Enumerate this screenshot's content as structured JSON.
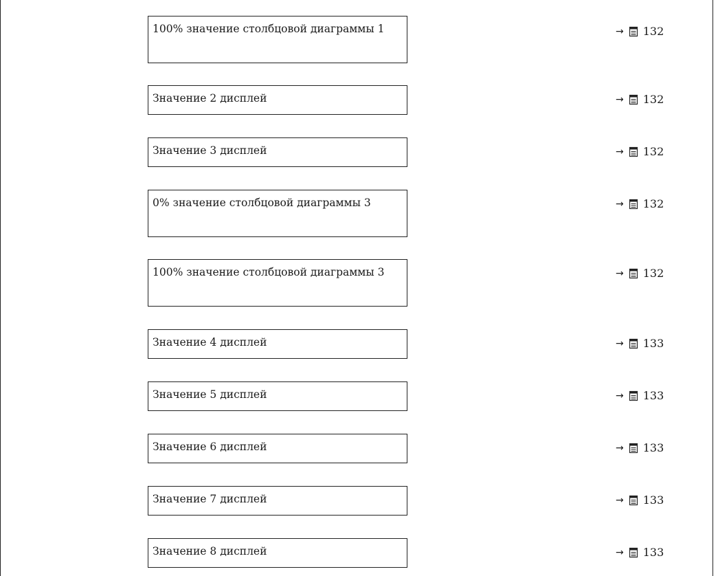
{
  "rows": [
    {
      "label": "100% значение столбцовой диаграммы 1",
      "page": "132"
    },
    {
      "label": "Значение 2 дисплей",
      "page": "132"
    },
    {
      "label": "Значение 3 дисплей",
      "page": "132"
    },
    {
      "label": "0% значение столбцовой диаграммы 3",
      "page": "132"
    },
    {
      "label": "100% значение столбцовой диаграммы 3",
      "page": "132"
    },
    {
      "label": "Значение 4 дисплей",
      "page": "133"
    },
    {
      "label": "Значение 5 дисплей",
      "page": "133"
    },
    {
      "label": "Значение 6 дисплей",
      "page": "133"
    },
    {
      "label": "Значение 7 дисплей",
      "page": "133"
    },
    {
      "label": "Значение 8 дисплей",
      "page": "133"
    }
  ],
  "ref_arrow": "→",
  "ref_icon": "page-reference-icon"
}
